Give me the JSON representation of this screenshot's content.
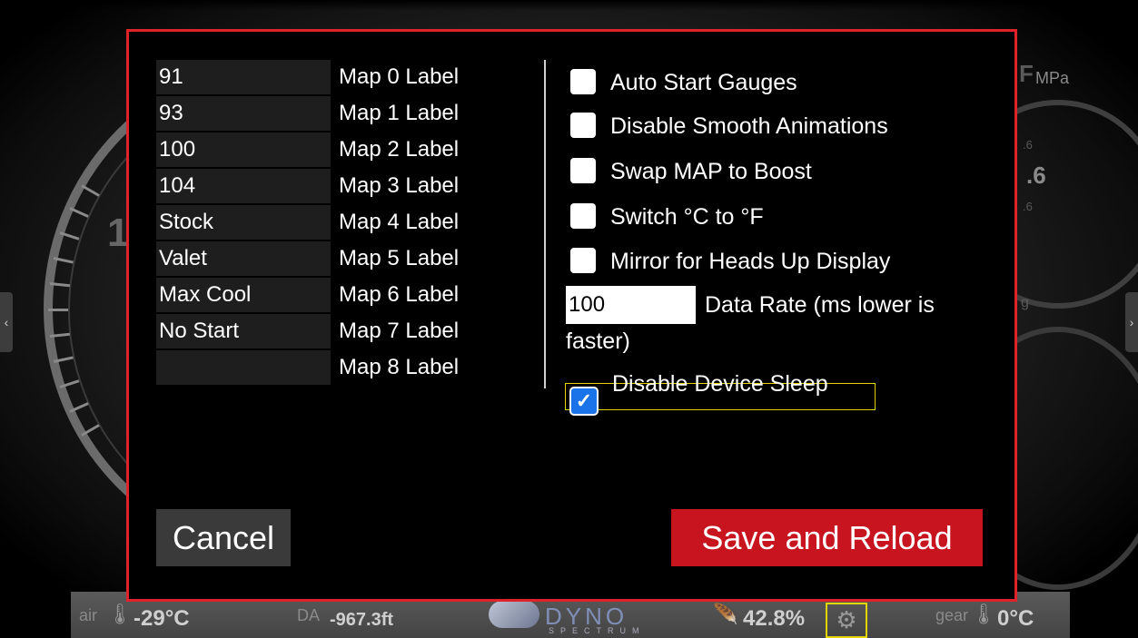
{
  "background": {
    "gauge_digit": "1",
    "right_unit": "MPa",
    "right_unit_prefix": "F",
    "right_value": ".6",
    "right_small_top": ".6",
    "right_small_bottom": ".6",
    "right_small_g": "g",
    "left_arrow": "‹",
    "right_arrow": "›"
  },
  "status_bar": {
    "air_label": "air",
    "air_value": "-29°C",
    "da_label": "DA",
    "da_value": "-967.3ft",
    "logo_text": "DYNO",
    "logo_sub": "SPECTRUM",
    "throttle_value": "42.8%",
    "gear_label": "gear",
    "gear_value": "0°C"
  },
  "dialog": {
    "maps": [
      {
        "value": "91",
        "label": "Map 0 Label"
      },
      {
        "value": "93",
        "label": "Map 1 Label"
      },
      {
        "value": "100",
        "label": "Map 2 Label"
      },
      {
        "value": "104",
        "label": "Map 3 Label"
      },
      {
        "value": "Stock",
        "label": "Map 4 Label"
      },
      {
        "value": "Valet",
        "label": "Map 5 Label"
      },
      {
        "value": "Max Cool",
        "label": "Map 6 Label"
      },
      {
        "value": "No Start",
        "label": "Map 7 Label"
      },
      {
        "value": "",
        "label": "Map 8 Label"
      }
    ],
    "options": [
      {
        "label": "Auto Start Gauges",
        "checked": false
      },
      {
        "label": "Disable Smooth Animations",
        "checked": false
      },
      {
        "label": "Swap MAP to Boost",
        "checked": false
      },
      {
        "label": "Switch °C to °F",
        "checked": false
      },
      {
        "label": "Mirror for Heads Up Display",
        "checked": false
      }
    ],
    "data_rate_value": "100",
    "data_rate_label": "Data Rate (ms lower is",
    "data_rate_label2": "faster)",
    "sleep_label": "Disable Device Sleep",
    "sleep_checked": true,
    "cancel_label": "Cancel",
    "save_label": "Save and Reload"
  },
  "colors": {
    "dialog_border": "#e0232b",
    "save_button": "#c8141f",
    "focus_outline": "#e3d600",
    "checkbox_checked": "#1a73e8"
  }
}
